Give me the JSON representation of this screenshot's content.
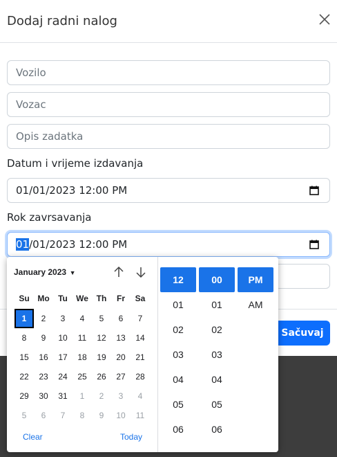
{
  "modal": {
    "title": "Dodaj radni nalog",
    "fields": {
      "vozilo_placeholder": "Vozilo",
      "vozac_placeholder": "Vozac",
      "opis_placeholder": "Opis zadatka"
    },
    "issue_label": "Datum i vrijeme izdavanja",
    "issue_value": "01/01/2023 12:00  PM",
    "deadline_label": "Rok zavrsavanja",
    "deadline_value_selected": "01",
    "deadline_value_rest": "/01/2023 12:00  PM",
    "save_label": "Sačuvaj"
  },
  "picker": {
    "month_label": "January 2023",
    "weekdays": [
      "Su",
      "Mo",
      "Tu",
      "We",
      "Th",
      "Fr",
      "Sa"
    ],
    "weeks": [
      [
        "1",
        "2",
        "3",
        "4",
        "5",
        "6",
        "7"
      ],
      [
        "8",
        "9",
        "10",
        "11",
        "12",
        "13",
        "14"
      ],
      [
        "15",
        "16",
        "17",
        "18",
        "19",
        "20",
        "21"
      ],
      [
        "22",
        "23",
        "24",
        "25",
        "26",
        "27",
        "28"
      ],
      [
        "29",
        "30",
        "31",
        "1",
        "2",
        "3",
        "4"
      ],
      [
        "5",
        "6",
        "7",
        "8",
        "9",
        "10",
        "11"
      ]
    ],
    "selected_day": "1",
    "clear_label": "Clear",
    "today_label": "Today",
    "hours": [
      "12",
      "01",
      "02",
      "03",
      "04",
      "05",
      "06"
    ],
    "minutes": [
      "00",
      "01",
      "02",
      "03",
      "04",
      "05",
      "06"
    ],
    "ampm": [
      "PM",
      "AM"
    ]
  },
  "colors": {
    "accent": "#1a73e8",
    "primary_button": "#0d6efd",
    "backdrop": "#3d3d3d"
  }
}
